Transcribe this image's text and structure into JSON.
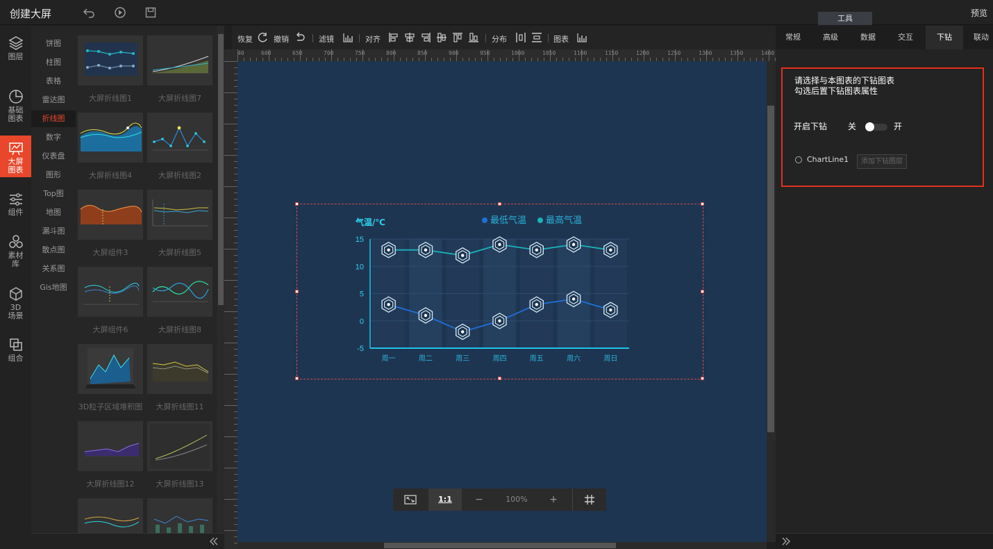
{
  "app": {
    "title": "创建大屏",
    "preview_label": "预览",
    "tool_tab": "工具"
  },
  "leftnav": [
    {
      "label": "图层",
      "icon": "layers-icon"
    },
    {
      "label": "基础图表",
      "icon": "pie-chart-icon"
    },
    {
      "label": "大屏图表",
      "icon": "screen-chart-icon",
      "active": true
    },
    {
      "label": "组件",
      "icon": "sliders-icon"
    },
    {
      "label": "素材库",
      "icon": "assets-icon"
    },
    {
      "label": "3D场景",
      "icon": "cube-icon"
    },
    {
      "label": "组合",
      "icon": "group-icon"
    }
  ],
  "categories": [
    "饼图",
    "柱图",
    "表格",
    "雷达图",
    "折线图",
    "数字",
    "仪表盘",
    "图形",
    "Top图",
    "地图",
    "漏斗图",
    "散点图",
    "关系图",
    "Gis地图"
  ],
  "active_category": "折线图",
  "templates": [
    "大屏折线图1",
    "大屏折线图7",
    "大屏折线图4",
    "大屏折线图2",
    "大屏组件3",
    "大屏折线图5",
    "大屏组件6",
    "大屏折线图8",
    "3D粒子区域堆积图",
    "大屏折线图11",
    "大屏折线图12",
    "大屏折线图13"
  ],
  "toolbar": {
    "restore": "恢复",
    "undo": "撤销",
    "filter": "滤镜",
    "align": "对齐",
    "distribute": "分布",
    "chart": "图表"
  },
  "ruler_h": [
    "750",
    "800",
    "850",
    "900",
    "950",
    "1000",
    "1050",
    "1100",
    "1150",
    "1200",
    "1250",
    "1300",
    "1350",
    "1400"
  ],
  "ruler_h_first": [
    "40",
    "600",
    "650",
    "700"
  ],
  "ruler_v": [
    "100",
    "150",
    "200",
    "250",
    "300",
    "350",
    "400",
    "450",
    "500",
    "550",
    "600",
    "650",
    "700",
    "750",
    "800"
  ],
  "zoom": {
    "fit_label": "",
    "one_to_one": "1:1",
    "minus": "−",
    "value": "100%",
    "plus": "+"
  },
  "right": {
    "tabs": [
      "常规",
      "高级",
      "数据",
      "交互",
      "下钻",
      "联动"
    ],
    "active_tab": "下钻",
    "drill_title_1": "请选择与本图表的下钻图表",
    "drill_title_2": "勾选后置下钻图表属性",
    "enable_label": "开启下钻",
    "off_label": "关",
    "on_label": "开",
    "enabled_state": "off",
    "chart_name": "ChartLine1",
    "add_layer_placeholder": "添加下钻图层"
  },
  "chart_data": {
    "type": "line",
    "ylabel": "气温/℃",
    "categories": [
      "周一",
      "周二",
      "周三",
      "周四",
      "周五",
      "周六",
      "周日"
    ],
    "ylim": [
      -5,
      15
    ],
    "yticks": [
      "15",
      "10",
      "5",
      "0",
      "-5"
    ],
    "series": [
      {
        "name": "最低气温",
        "values": [
          3,
          1,
          -2,
          0,
          3,
          4,
          2
        ],
        "color": "#1e6fd9"
      },
      {
        "name": "最高气温",
        "values": [
          13,
          13,
          12,
          14,
          13,
          14,
          13
        ],
        "color": "#1ab2b8"
      }
    ]
  }
}
